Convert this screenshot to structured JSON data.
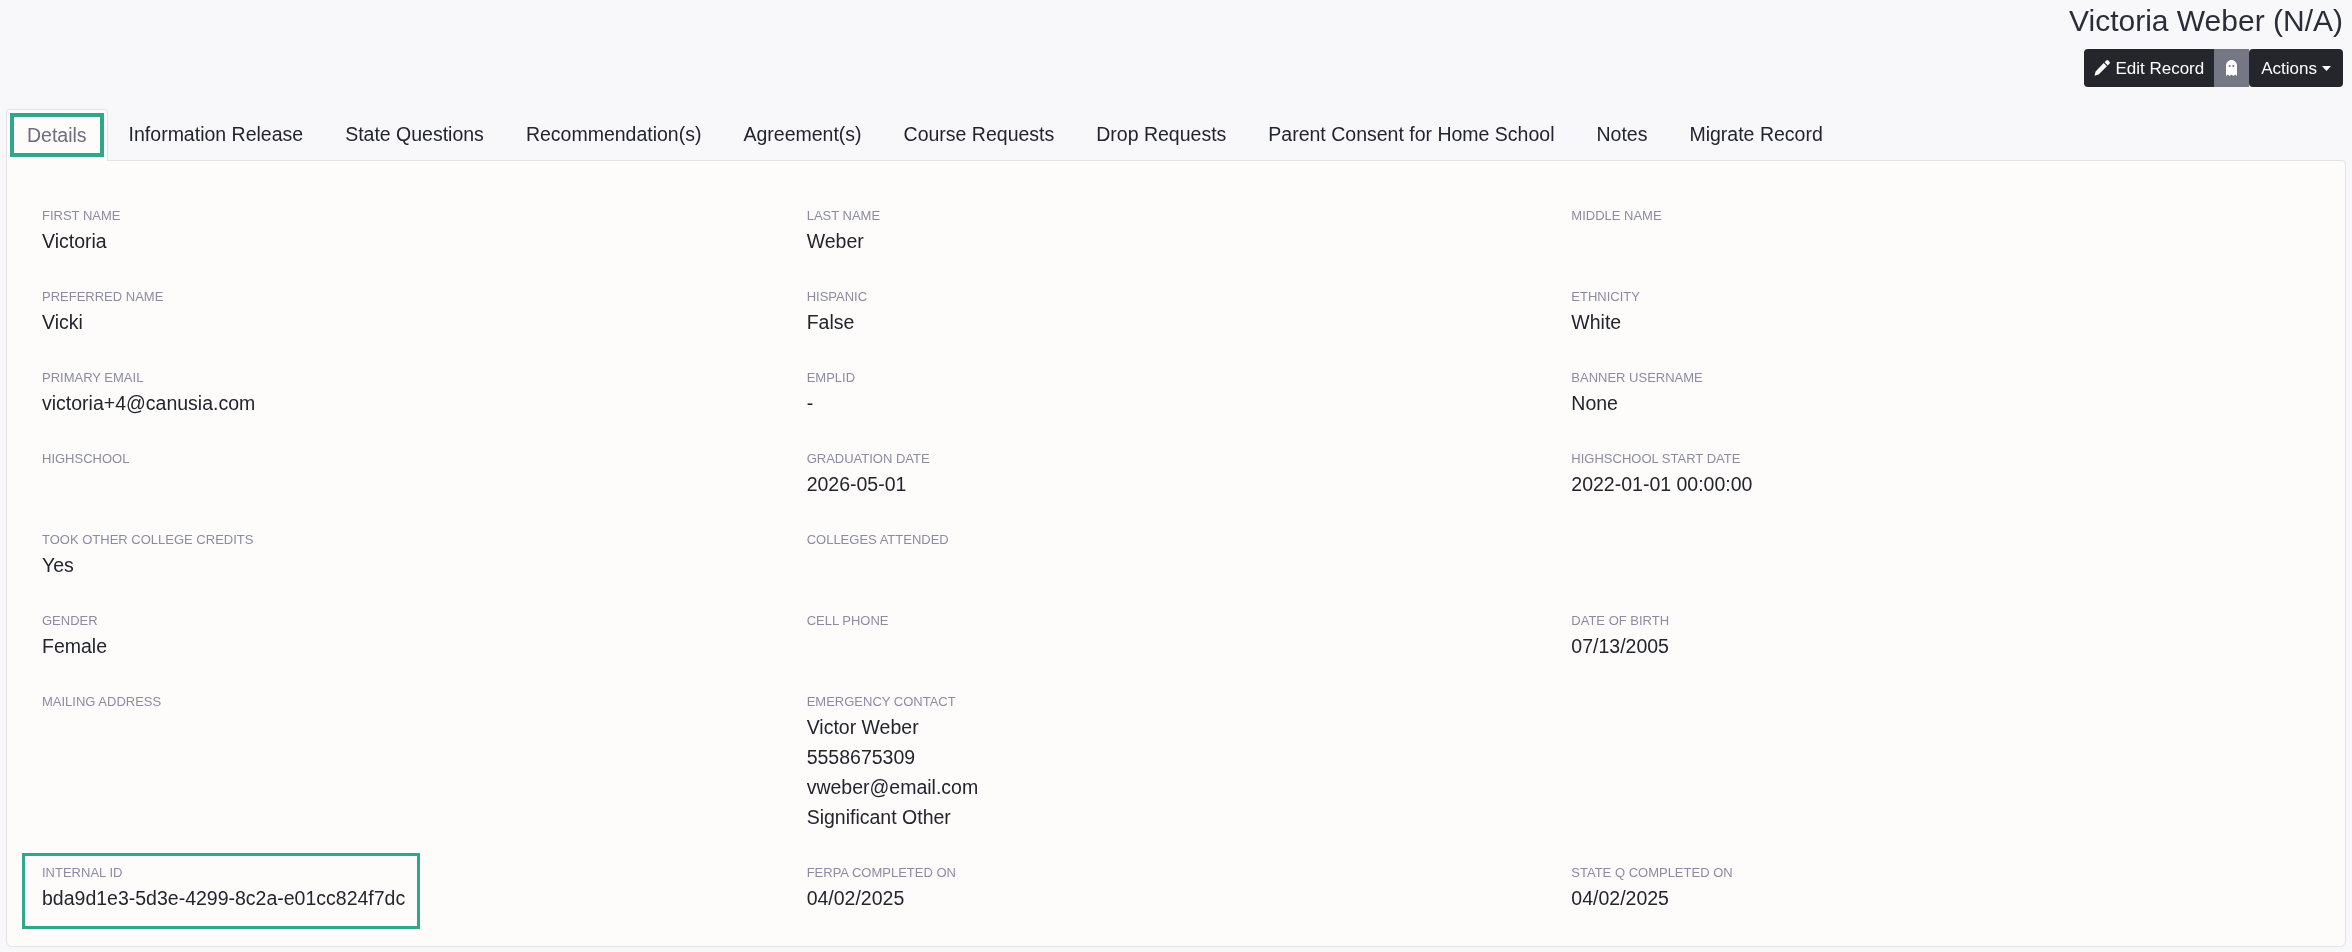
{
  "header": {
    "title": "Victoria Weber (N/A)",
    "buttons": [
      {
        "kind": "edit",
        "label": "Edit Record"
      },
      {
        "kind": "ghost"
      },
      {
        "kind": "dropdown",
        "label": "Actions"
      }
    ]
  },
  "tabs": [
    {
      "label": "Details",
      "selected": true,
      "highlighted": true
    },
    {
      "label": "Information Release",
      "selected": false,
      "highlighted": false
    },
    {
      "label": "State Questions",
      "selected": false,
      "highlighted": false
    },
    {
      "label": "Recommendation(s)",
      "selected": false,
      "highlighted": false
    },
    {
      "label": "Agreement(s)",
      "selected": false,
      "highlighted": false
    },
    {
      "label": "Course Requests",
      "selected": false,
      "highlighted": false
    },
    {
      "label": "Drop Requests",
      "selected": false,
      "highlighted": false
    },
    {
      "label": "Parent Consent for Home School",
      "selected": false,
      "highlighted": false
    },
    {
      "label": "Notes",
      "selected": false,
      "highlighted": false
    },
    {
      "label": "Migrate Record",
      "selected": false,
      "highlighted": false
    }
  ],
  "details": {
    "rows": [
      [
        {
          "label": "FIRST NAME",
          "value": "Victoria",
          "highlighted": false
        },
        {
          "label": "LAST NAME",
          "value": "Weber",
          "highlighted": false
        },
        {
          "label": "MIDDLE NAME",
          "highlighted": false
        }
      ],
      [
        {
          "label": "PREFERRED NAME",
          "value": "Vicki",
          "highlighted": false
        },
        {
          "label": "HISPANIC",
          "value": "False",
          "highlighted": false
        },
        {
          "label": "ETHNICITY",
          "value": "White",
          "highlighted": false
        }
      ],
      [
        {
          "label": "PRIMARY EMAIL",
          "value": "victoria+4@canusia.com",
          "highlighted": false
        },
        {
          "label": "EMPLID",
          "value": "-",
          "highlighted": false
        },
        {
          "label": "BANNER USERNAME",
          "value": "None",
          "highlighted": false
        }
      ],
      [
        {
          "label": "HIGHSCHOOL",
          "highlighted": false
        },
        {
          "label": "GRADUATION DATE",
          "value": "2026-05-01",
          "highlighted": false
        },
        {
          "label": "HIGHSCHOOL START DATE",
          "value": "2022-01-01 00:00:00",
          "highlighted": false
        }
      ],
      [
        {
          "label": "TOOK OTHER COLLEGE CREDITS",
          "value": "Yes",
          "highlighted": false
        },
        {
          "label": "COLLEGES ATTENDED",
          "highlighted": false
        }
      ],
      [
        {
          "label": "GENDER",
          "value": "Female",
          "highlighted": false
        },
        {
          "label": "CELL PHONE",
          "highlighted": false
        },
        {
          "label": "DATE OF BIRTH",
          "value": "07/13/2005",
          "highlighted": false
        }
      ],
      [
        {
          "label": "MAILING ADDRESS",
          "highlighted": false
        },
        {
          "label": "EMERGENCY CONTACT",
          "lines": [
            "Victor Weber",
            "5558675309",
            "vweber@email.com",
            "Significant Other"
          ],
          "highlighted": false
        }
      ],
      [
        {
          "label": "INTERNAL ID",
          "value": "bda9d1e3-5d3e-4299-8c2a-e01cc824f7dc",
          "highlighted": true
        },
        {
          "label": "FERPA COMPLETED ON",
          "value": "04/02/2025",
          "highlighted": false
        },
        {
          "label": "STATE Q COMPLETED ON",
          "value": "04/02/2025",
          "highlighted": false
        }
      ]
    ]
  }
}
